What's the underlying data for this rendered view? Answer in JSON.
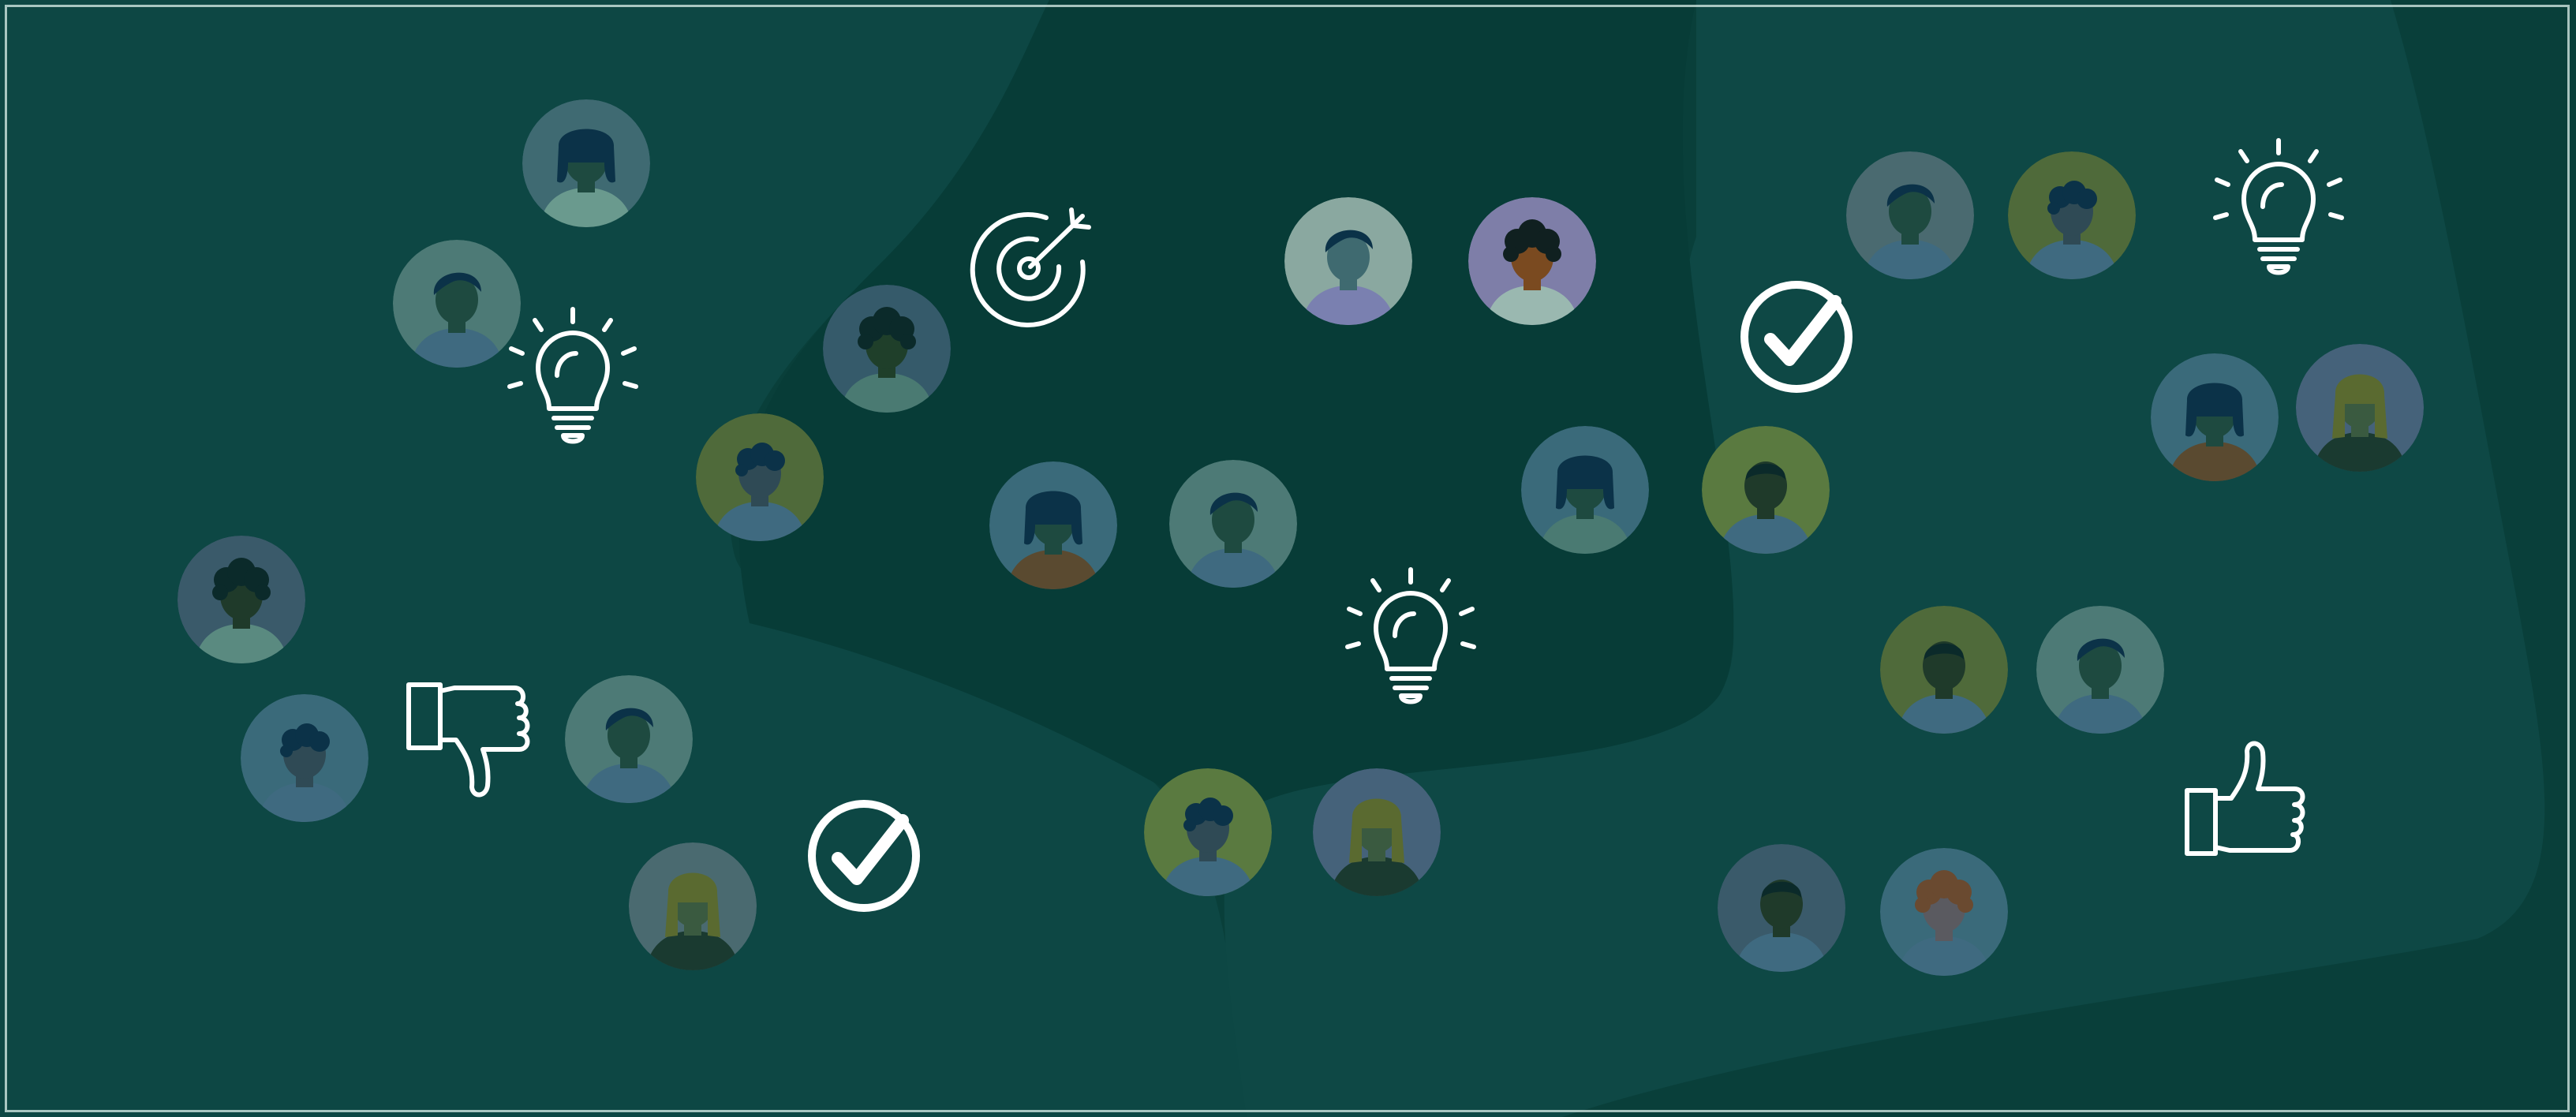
{
  "scene": {
    "background_color": "#093f3a",
    "shape_color": "#0f4a46",
    "icon_color": "#ffffff",
    "border_color": "#dcf0eb"
  },
  "avatars": [
    {
      "id": "a1",
      "bg": "#3f6a72",
      "skin": "#1e4a40",
      "hair": "#0b3248",
      "shirt": "#6a9a8e",
      "hair_style": "bob"
    },
    {
      "id": "a2",
      "bg": "#4d7a76",
      "skin": "#1e4a40",
      "hair": "#0b3248",
      "shirt": "#3f6a80",
      "hair_style": "short"
    },
    {
      "id": "a3",
      "bg": "#355a6a",
      "skin": "#1f3f2a",
      "hair": "#0b2a2a",
      "shirt": "#4a7a72",
      "hair_style": "curly"
    },
    {
      "id": "a4",
      "bg": "#4f6a3a",
      "skin": "#2f4a55",
      "hair": "#0b3248",
      "shirt": "#3f6a80",
      "hair_style": "wavy"
    },
    {
      "id": "a5",
      "bg": "#3a5a6a",
      "skin": "#1f3a2a",
      "hair": "#0b2a2a",
      "shirt": "#5a8a80",
      "hair_style": "curly"
    },
    {
      "id": "a6",
      "bg": "#3a6a7a",
      "skin": "#2f4a55",
      "hair": "#0b3248",
      "shirt": "#3f6a80",
      "hair_style": "wavy"
    },
    {
      "id": "a7",
      "bg": "#4d7a76",
      "skin": "#1e4a40",
      "hair": "#0b3248",
      "shirt": "#3f6a80",
      "hair_style": "short"
    },
    {
      "id": "a8",
      "bg": "#4a6a70",
      "skin": "#3a5a40",
      "hair": "#5a6a30",
      "shirt": "#1a3a30",
      "hair_style": "long"
    },
    {
      "id": "a9",
      "bg": "#3a6a7a",
      "skin": "#1e4a40",
      "hair": "#0b3248",
      "shirt": "#5a4a30",
      "hair_style": "bob"
    },
    {
      "id": "a10",
      "bg": "#4d7a76",
      "skin": "#1e4a40",
      "hair": "#0b3248",
      "shirt": "#3f6a80",
      "hair_style": "short"
    },
    {
      "id": "a11",
      "bg": "#5a7a40",
      "skin": "#2f4a55",
      "hair": "#0b3248",
      "shirt": "#3f6a80",
      "hair_style": "wavy"
    },
    {
      "id": "a12",
      "bg": "#45627a",
      "skin": "#3a5a40",
      "hair": "#5a6a30",
      "shirt": "#1a3a30",
      "hair_style": "long"
    },
    {
      "id": "a13",
      "bg": "#8aa8a0",
      "skin": "#3f6a70",
      "hair": "#0b3248",
      "shirt": "#7a80b0",
      "hair_style": "short"
    },
    {
      "id": "a14",
      "bg": "#7e7ea8",
      "skin": "#7a4a20",
      "hair": "#102020",
      "shirt": "#9ab8b0",
      "hair_style": "curly"
    },
    {
      "id": "a15",
      "bg": "#3a6a7a",
      "skin": "#1e4a40",
      "hair": "#0b3248",
      "shirt": "#4a7a72",
      "hair_style": "bob"
    },
    {
      "id": "a16",
      "bg": "#5a7a40",
      "skin": "#1f3a2a",
      "hair": "#0b2a2a",
      "shirt": "#3f6a80",
      "hair_style": "buzz"
    },
    {
      "id": "a17",
      "bg": "#4a6a70",
      "skin": "#1e4a40",
      "hair": "#0b3248",
      "shirt": "#3f6a80",
      "hair_style": "short"
    },
    {
      "id": "a18",
      "bg": "#4f6a3a",
      "skin": "#2f4a55",
      "hair": "#0b3248",
      "shirt": "#3f6a80",
      "hair_style": "wavy"
    },
    {
      "id": "a19",
      "bg": "#3a6a7a",
      "skin": "#1e4a40",
      "hair": "#0b3248",
      "shirt": "#5a4a30",
      "hair_style": "bob"
    },
    {
      "id": "a20",
      "bg": "#45627a",
      "skin": "#3a5a40",
      "hair": "#5a6a30",
      "shirt": "#1a3a30",
      "hair_style": "long"
    },
    {
      "id": "a21",
      "bg": "#4f6a3a",
      "skin": "#1f3a2a",
      "hair": "#0b2a2a",
      "shirt": "#3f6a80",
      "hair_style": "buzz"
    },
    {
      "id": "a22",
      "bg": "#4d7a76",
      "skin": "#1e4a40",
      "hair": "#0b3248",
      "shirt": "#3f6a80",
      "hair_style": "short"
    },
    {
      "id": "a23",
      "bg": "#3a5a6a",
      "skin": "#1f3a2a",
      "hair": "#0b2a2a",
      "shirt": "#3f6a80",
      "hair_style": "buzz"
    },
    {
      "id": "a24",
      "bg": "#3a6a7a",
      "skin": "#5a5a60",
      "hair": "#6a4a30",
      "shirt": "#3f6a80",
      "hair_style": "curly"
    }
  ],
  "icons": [
    {
      "id": "i1",
      "kind": "lightbulb"
    },
    {
      "id": "i2",
      "kind": "thumbs-down"
    },
    {
      "id": "i3",
      "kind": "checkmark"
    },
    {
      "id": "i4",
      "kind": "target"
    },
    {
      "id": "i5",
      "kind": "lightbulb"
    },
    {
      "id": "i6",
      "kind": "checkmark"
    },
    {
      "id": "i7",
      "kind": "lightbulb"
    },
    {
      "id": "i8",
      "kind": "thumbs-up"
    }
  ]
}
